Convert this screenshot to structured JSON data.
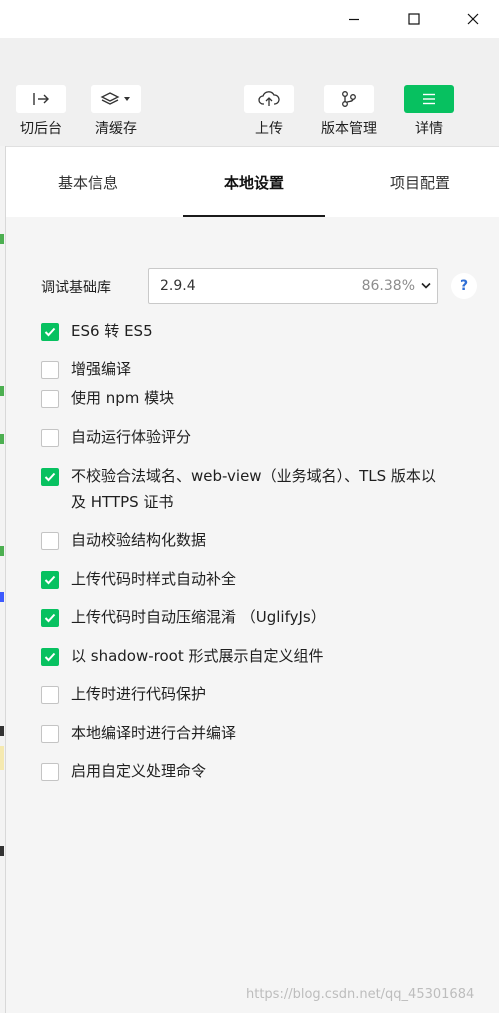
{
  "window": {
    "controls": [
      "minimize-icon",
      "maximize-icon",
      "close-icon"
    ]
  },
  "toolbar": {
    "left": [
      {
        "name": "switch-background",
        "label": "切后台",
        "icon": "exit-arrow-icon"
      },
      {
        "name": "clear-cache",
        "label": "清缓存",
        "icon": "layers-icon"
      }
    ],
    "right": [
      {
        "name": "upload",
        "label": "上传",
        "icon": "cloud-upload-icon"
      },
      {
        "name": "version-control",
        "label": "版本管理",
        "icon": "branch-icon"
      },
      {
        "name": "details",
        "label": "详情",
        "icon": "menu-icon",
        "accent": "#07c160"
      }
    ]
  },
  "tabs": [
    {
      "label": "基本信息",
      "active": false
    },
    {
      "label": "本地设置",
      "active": true
    },
    {
      "label": "项目配置",
      "active": false
    }
  ],
  "base_library": {
    "label": "调试基础库",
    "version": "2.9.4",
    "percent": "86.38%",
    "help": "?"
  },
  "options": [
    {
      "label": "ES6 转 ES5",
      "checked": true
    },
    {
      "label": "增强编译",
      "checked": false
    },
    {
      "label": "使用 npm 模块",
      "checked": false
    },
    {
      "label": "自动运行体验评分",
      "checked": false
    },
    {
      "label": "不校验合法域名、web-view（业务域名）、TLS 版本以及 HTTPS 证书",
      "checked": true
    },
    {
      "label": "自动校验结构化数据",
      "checked": false
    },
    {
      "label": "上传代码时样式自动补全",
      "checked": true
    },
    {
      "label": "上传代码时自动压缩混淆 （UglifyJs）",
      "checked": true
    },
    {
      "label": "以 shadow-root 形式展示自定义组件",
      "checked": true
    },
    {
      "label": "上传时进行代码保护",
      "checked": false
    },
    {
      "label": "本地编译时进行合并编译",
      "checked": false
    },
    {
      "label": "启用自定义处理命令",
      "checked": false
    }
  ],
  "watermark": "https://blog.csdn.net/qq_45301684",
  "colors": {
    "accent": "#07c160",
    "help": "#2f6fd6"
  }
}
